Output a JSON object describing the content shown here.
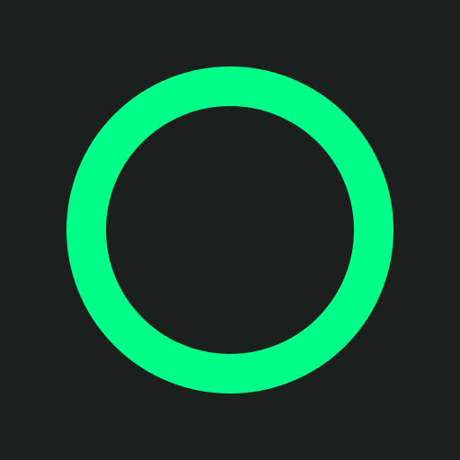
{
  "icon": {
    "name": "circle-outline-icon",
    "shape": "ring"
  },
  "colors": {
    "background": "#1b201f",
    "ring": "#00ff88"
  }
}
